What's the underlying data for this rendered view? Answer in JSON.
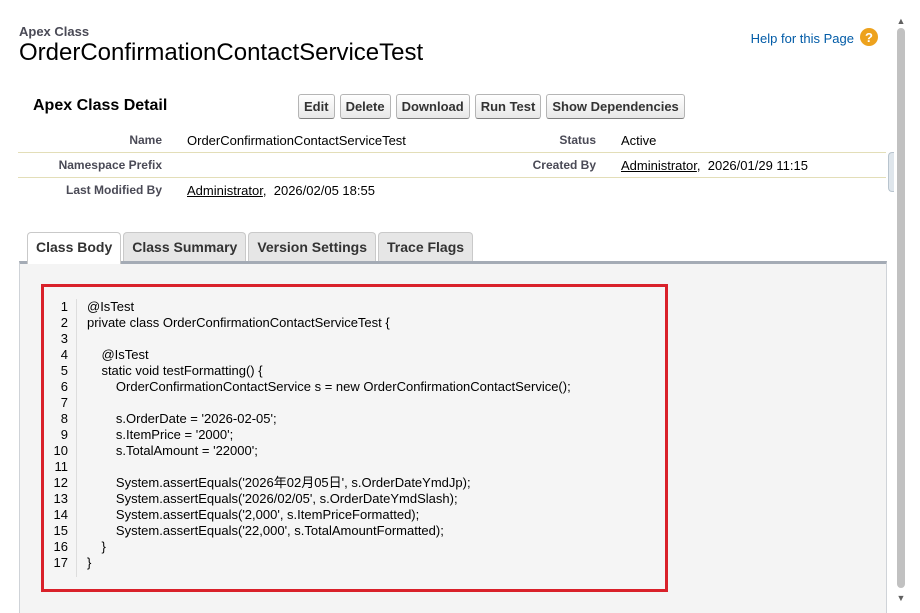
{
  "header": {
    "object_type": "Apex Class",
    "class_name": "OrderConfirmationContactServiceTest",
    "help_link": "Help for this Page",
    "help_icon": "question-circle-icon"
  },
  "detail": {
    "section_title": "Apex Class Detail",
    "buttons": {
      "edit": "Edit",
      "delete": "Delete",
      "download": "Download",
      "run_test": "Run Test",
      "show_dependencies": "Show Dependencies"
    },
    "fields": {
      "name_label": "Name",
      "name_value": "OrderConfirmationContactServiceTest",
      "status_label": "Status",
      "status_value": "Active",
      "namespace_label": "Namespace Prefix",
      "namespace_value": "",
      "created_by_label": "Created By",
      "created_by_user": "Administrator",
      "created_by_sep": ",",
      "created_by_date": "2026/01/29 11:15",
      "modified_by_label": "Last Modified By",
      "modified_by_user": "Administrator",
      "modified_by_sep": ",",
      "modified_by_date": "2026/02/05 18:55"
    }
  },
  "tabs": {
    "class_body": "Class Body",
    "class_summary": "Class Summary",
    "version_settings": "Version Settings",
    "trace_flags": "Trace Flags",
    "active": "class_body"
  },
  "code": {
    "line_numbers": [
      "1",
      "2",
      "3",
      "4",
      "5",
      "6",
      "7",
      "8",
      "9",
      "10",
      "11",
      "12",
      "13",
      "14",
      "15",
      "16",
      "17"
    ],
    "lines": [
      "@IsTest",
      "private class OrderConfirmationContactServiceTest {",
      "",
      "    @IsTest",
      "    static void testFormatting() {",
      "        OrderConfirmationContactService s = new OrderConfirmationContactService();",
      "",
      "        s.OrderDate = '2026-02-05';",
      "        s.ItemPrice = '2000';",
      "        s.TotalAmount = '22000';",
      "",
      "        System.assertEquals('2026年02月05日', s.OrderDateYmdJp);",
      "        System.assertEquals('2026/02/05', s.OrderDateYmdSlash);",
      "        System.assertEquals('2,000', s.ItemPriceFormatted);",
      "        System.assertEquals('22,000', s.TotalAmountFormatted);",
      "    }",
      "}"
    ],
    "highlight_color": "#d9212a"
  },
  "colors": {
    "accent_link": "#015ba7",
    "help_icon": "#eda21d",
    "field_divider": "#e3deb8"
  }
}
